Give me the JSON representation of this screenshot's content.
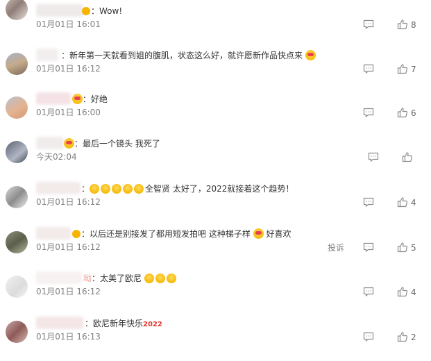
{
  "comments": [
    {
      "text": "Wow!",
      "time": "01月01日 16:01",
      "likes": "8"
    },
    {
      "text": "新年第一天就看到姐的腹肌，状态这么好，就许愿新作品快点来",
      "time": "01月01日 16:12",
      "likes": "7"
    },
    {
      "text": "好绝",
      "time": "01月01日 16:00",
      "likes": "6"
    },
    {
      "text": "最后一个镜头 我死了",
      "time": "今天02:04",
      "likes": ""
    },
    {
      "text": "全智贤 太好了，2022就接着这个趋势！",
      "time": "01月01日 16:12",
      "likes": "4"
    },
    {
      "text_a": "以后还是别接发了都用短发拍吧 这种梯子样",
      "text_b": "好喜欢",
      "time": "01月01日 16:12",
      "likes": "5",
      "report": "投诉"
    },
    {
      "name_tail": "呦",
      "text": "太美了欧尼",
      "time": "01月01日 16:12",
      "likes": "4"
    },
    {
      "text": "欧尼新年快乐",
      "tag": "2022",
      "time": "01月01日 16:13",
      "likes": "2"
    }
  ],
  "icons": {
    "reply": "comment-icon",
    "like": "thumbs-up-icon",
    "vip": "vip-badge-icon",
    "emoji": "smile-emoji-icon"
  },
  "colors": {
    "time_gray": "#808080",
    "text": "#333333",
    "icon": "#8c8c8c"
  },
  "colon": "："
}
